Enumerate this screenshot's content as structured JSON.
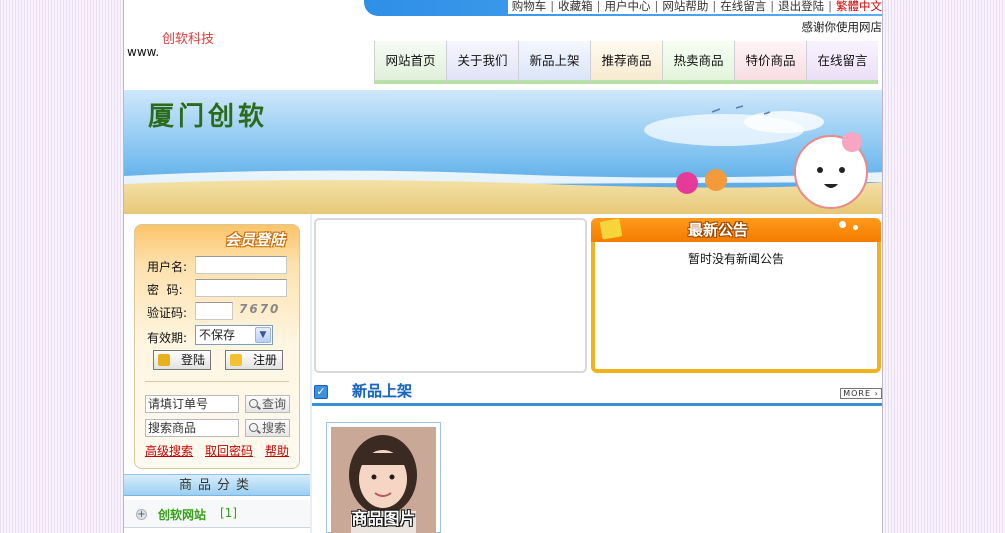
{
  "header": {
    "brand_name": "创软科技",
    "brand_www": "www.",
    "thanks_text": "感谢你使用网店",
    "top_links": [
      "购物车",
      "收藏箱",
      "用户中心",
      "网站帮助",
      "在线留言",
      "退出登陆"
    ],
    "lang_link": "繁體中文"
  },
  "nav": {
    "items": [
      "网站首页",
      "关于我们",
      "新品上架",
      "推荐商品",
      "热卖商品",
      "特价商品",
      "在线留言"
    ]
  },
  "banner": {
    "title": "厦门创软"
  },
  "login": {
    "title": "会员登陆",
    "username_label": "用户名:",
    "password_label": "密  码:",
    "captcha_label": "验证码:",
    "captcha_code": "7670",
    "expiry_label": "有效期:",
    "expiry_value": "不保存",
    "login_button": "登陆",
    "register_button": "注册"
  },
  "search": {
    "order_placeholder": "请填订单号",
    "order_button": "查询",
    "product_placeholder": "搜索商品",
    "product_button": "搜索",
    "advanced_link": "高级搜索",
    "recover_link": "取回密码",
    "help_link": "帮助"
  },
  "categories": {
    "header": "商品分类",
    "items": [
      {
        "name": "创软网站",
        "count": "[1]"
      }
    ]
  },
  "news": {
    "title": "最新公告",
    "empty_text": "暂时没有新闻公告"
  },
  "new_products": {
    "title": "新品上架",
    "more_label": "MORE",
    "product_caption": "商品图片"
  },
  "colors": {
    "accent_blue": "#3b8ed8",
    "news_orange": "#f57c00",
    "link_red": "#c40000",
    "category_green": "#36a018"
  }
}
